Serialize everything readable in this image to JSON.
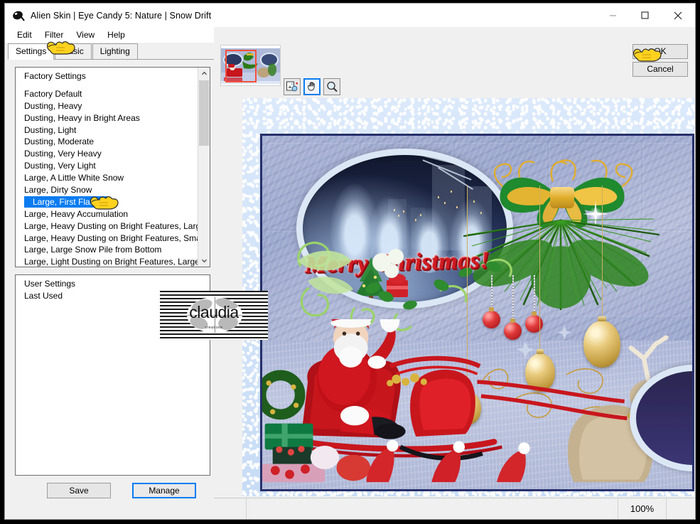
{
  "window": {
    "title": "Alien Skin | Eye Candy 5: Nature | Snow Drift",
    "app_icon": "alien-skin-icon",
    "controls": {
      "minimize": "—",
      "maximize": "□",
      "close": "✕"
    }
  },
  "menu": {
    "items": [
      "Edit",
      "Filter",
      "View",
      "Help"
    ]
  },
  "tabs": [
    {
      "label": "Settings",
      "active": true
    },
    {
      "label": "Basic",
      "active": false
    },
    {
      "label": "Lighting",
      "active": false
    }
  ],
  "factory_list": {
    "header": "Factory Settings",
    "items": [
      "Factory Default",
      "Dusting, Heavy",
      "Dusting, Heavy in Bright Areas",
      "Dusting, Light",
      "Dusting, Moderate",
      "Dusting, Very Heavy",
      "Dusting, Very Light",
      "Large, A Little White Snow",
      "Large, Dirty Snow",
      "Large, First Flakes",
      "Large, Heavy Accumulation",
      "Large, Heavy Dusting on Bright Features, Large Drift",
      "Large, Heavy Dusting on Bright Features, Small Drift",
      "Large, Large Snow Pile from Bottom",
      "Large, Light Dusting on Bright Features, Large Drift"
    ],
    "selected": "Large, First Flakes",
    "selected_index": 9,
    "scroll_up_icon": "chevron-up-icon",
    "scroll_down_icon": "chevron-down-icon"
  },
  "user_list": {
    "header": "User Settings",
    "items": [
      "Last Used"
    ]
  },
  "left_buttons": {
    "save": "Save",
    "manage": "Manage"
  },
  "preview_tools": {
    "navigator_label": "navigator-thumbnail",
    "buttons": [
      {
        "name": "preview-compare-icon",
        "active": false
      },
      {
        "name": "pan-hand-icon",
        "active": true
      },
      {
        "name": "zoom-magnifier-icon",
        "active": false
      }
    ]
  },
  "dialog_buttons": {
    "ok": "OK",
    "cancel": "Cancel"
  },
  "status_bar": {
    "zoom": "100%"
  },
  "watermark": {
    "text": "claudia",
    "subtext": "creations"
  },
  "preview_artwork": {
    "greeting": "Merry Christmas!",
    "description": "Christmas scrapbook page: oval window onto snowy night city, green-and-gold bow over pine branches, Santa in red sleigh with reindeer, gold and red baubles, wrapped gifts and red santa hats",
    "colors": {
      "wall": "#a0abd0",
      "greeting_red": "#cf1b22",
      "bow_green": "#1f8a2e",
      "bow_gold": "#e3b431",
      "sleigh_red": "#c8161d",
      "pine_green": "#2d7a18",
      "frame_navy": "#27306b"
    }
  },
  "cursors": [
    {
      "name": "pointing-hand-tabs"
    },
    {
      "name": "pointing-hand-list-selection"
    },
    {
      "name": "pointing-hand-ok-button"
    }
  ]
}
